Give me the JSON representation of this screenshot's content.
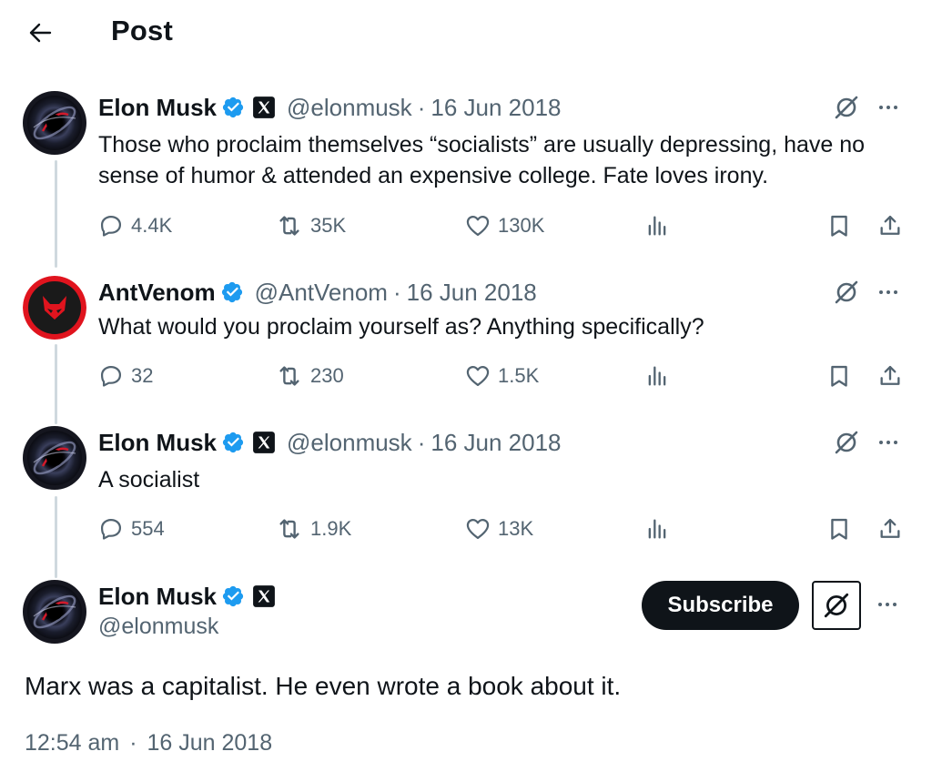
{
  "header": {
    "title": "Post"
  },
  "colors": {
    "verified": "#1d9bf0",
    "muted": "#536471",
    "text": "#0f1419",
    "thread_line": "#cfd9de"
  },
  "tweets": [
    {
      "name": "Elon Musk",
      "handle": "@elonmusk",
      "separator": "·",
      "date": "16 Jun 2018",
      "text": "Those who proclaim themselves “socialists” are usually depressing, have no sense of humor & attended an expensive college. Fate loves irony.",
      "replies": "4.4K",
      "reposts": "35K",
      "likes": "130K",
      "avatar_icon": "black-hole-avatar",
      "affiliate_badge": "x-logo"
    },
    {
      "name": "AntVenom",
      "handle": "@AntVenom",
      "separator": "·",
      "date": "16 Jun 2018",
      "text": "What would you proclaim yourself as? Anything specifically?",
      "replies": "32",
      "reposts": "230",
      "likes": "1.5K",
      "avatar_icon": "red-fox-avatar"
    },
    {
      "name": "Elon Musk",
      "handle": "@elonmusk",
      "separator": "·",
      "date": "16 Jun 2018",
      "text": "A socialist",
      "replies": "554",
      "reposts": "1.9K",
      "likes": "13K",
      "avatar_icon": "black-hole-avatar",
      "affiliate_badge": "x-logo"
    }
  ],
  "main_post": {
    "name": "Elon Musk",
    "handle": "@elonmusk",
    "subscribe_label": "Subscribe",
    "text": "Marx was a capitalist. He even wrote a book about it.",
    "time": "12:54 am",
    "separator": "·",
    "date": "16 Jun 2018",
    "avatar_icon": "black-hole-avatar",
    "affiliate_badge": "x-logo"
  }
}
